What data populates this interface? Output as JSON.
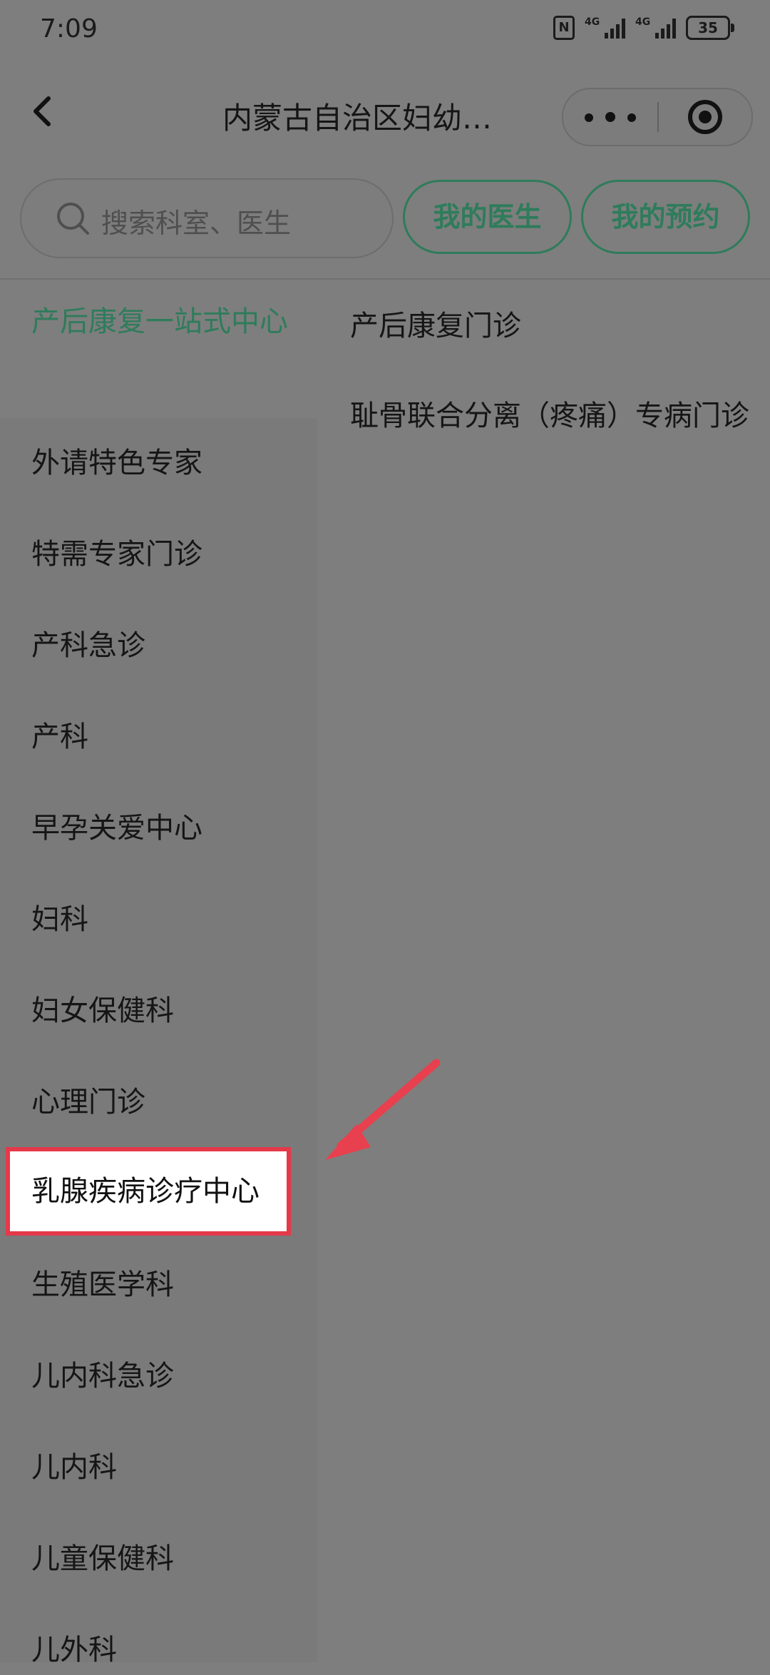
{
  "status_bar": {
    "time": "7:09",
    "nfc_label": "N",
    "signal_label_1": "4G",
    "signal_label_2": "4G",
    "battery": "35"
  },
  "nav": {
    "title": "内蒙古自治区妇幼…",
    "icons": [
      "back-icon",
      "more-icon",
      "target-icon"
    ]
  },
  "search": {
    "placeholder": "搜索科室、医生"
  },
  "buttons": {
    "my_doctor": "我的医生",
    "my_appointment": "我的预约"
  },
  "sidebar": {
    "active": "产后康复一站式中心",
    "items": [
      "外请特色专家",
      "特需专家门诊",
      "产科急诊",
      "产科",
      "早孕关爱中心",
      "妇科",
      "妇女保健科",
      "心理门诊",
      "乳腺疾病诊疗中心",
      "生殖医学科",
      "儿内科急诊",
      "儿内科",
      "儿童保健科",
      "儿外科"
    ]
  },
  "main": {
    "items": [
      "产后康复门诊",
      "耻骨联合分离（疼痛）专病门诊"
    ]
  },
  "colors": {
    "accent_green": "#2e7c5b",
    "highlight_red": "#e5394a",
    "arrow_red": "#e8404e",
    "overlay_gray": "#7e7e7e"
  }
}
